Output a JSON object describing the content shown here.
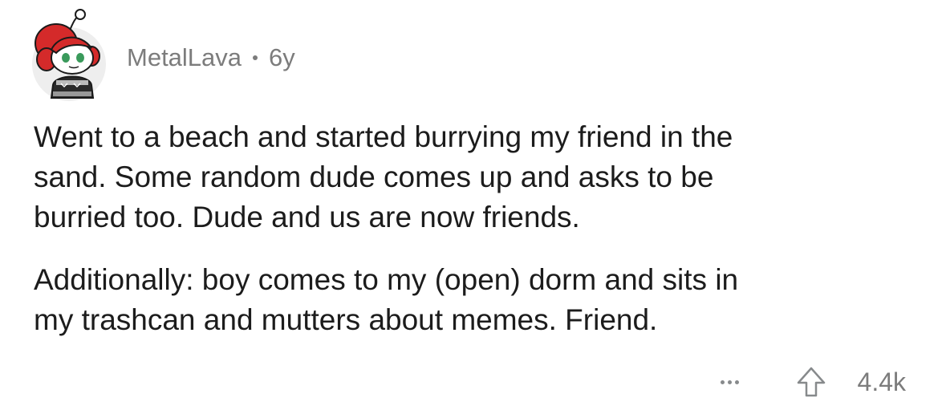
{
  "comment": {
    "author": "MetalLava",
    "age": "6y",
    "paragraphs": [
      "Went to a beach and started burrying my friend in the\nsand. Some random dude comes up and asks to be\nburried too. Dude and us are now friends.",
      "Additionally: boy comes to my (open) dorm and sits in\nmy trashcan and mutters about memes. Friend."
    ],
    "score": "4.4k",
    "icons": {
      "avatar": "snoo-avatar-red-hair",
      "more": "more-options-icon",
      "upvote": "upvote-arrow-icon"
    },
    "colors": {
      "meta_text": "#7c7c7c",
      "body_text": "#1c1c1c",
      "avatar_hair": "#d42a2a",
      "avatar_eyes": "#3a9a5b"
    }
  }
}
